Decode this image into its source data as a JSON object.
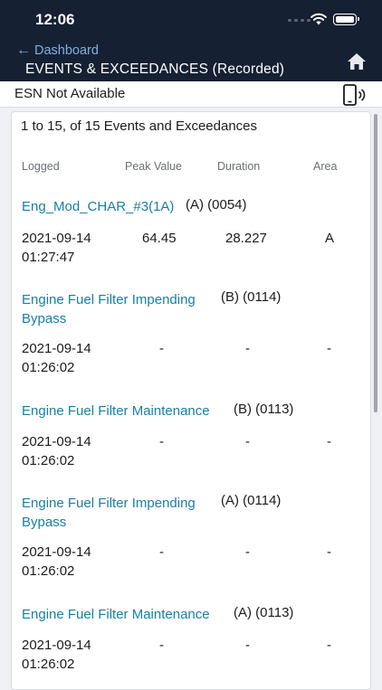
{
  "status": {
    "time": "12:06"
  },
  "nav": {
    "back_label": "Dashboard",
    "title": "EVENTS & EXCEEDANCES (Recorded)"
  },
  "esn": {
    "label": "ESN Not Available"
  },
  "list": {
    "summary": "1 to 15, of 15 Events and Exceedances",
    "columns": {
      "logged": "Logged",
      "peak": "Peak Value",
      "duration": "Duration",
      "area": "Area"
    },
    "events": [
      {
        "title": "Eng_Mod_CHAR_#3(1A)",
        "suffix": "(A) (0054)",
        "date": "2021-09-14",
        "time": "01:27:47",
        "peak": "64.45",
        "duration": "28.227",
        "area": "A"
      },
      {
        "title": "Engine Fuel Filter Impending Bypass",
        "suffix": "(B) (0114)",
        "date": "2021-09-14",
        "time": "01:26:02",
        "peak": "-",
        "duration": "-",
        "area": "-"
      },
      {
        "title": "Engine Fuel Filter Maintenance",
        "suffix": "(B) (0113)",
        "date": "2021-09-14",
        "time": "01:26:02",
        "peak": "-",
        "duration": "-",
        "area": "-"
      },
      {
        "title": "Engine Fuel Filter Impending Bypass",
        "suffix": "(A) (0114)",
        "date": "2021-09-14",
        "time": "01:26:02",
        "peak": "-",
        "duration": "-",
        "area": "-"
      },
      {
        "title": "Engine Fuel Filter Maintenance",
        "suffix": "(A) (0113)",
        "date": "2021-09-14",
        "time": "01:26:02",
        "peak": "-",
        "duration": "-",
        "area": "-"
      }
    ]
  }
}
